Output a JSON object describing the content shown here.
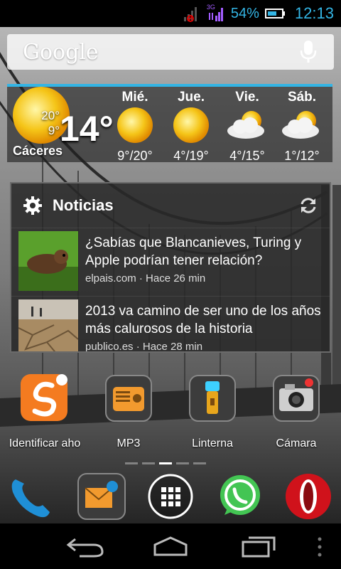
{
  "status_bar": {
    "network_type": "3G",
    "battery_percent": "54%",
    "time": "12:13"
  },
  "search": {
    "logo_text": "Google",
    "mic_icon": "microphone-icon"
  },
  "weather": {
    "high": "20°",
    "low": "9°",
    "current_temp": "14°",
    "city": "Cáceres",
    "forecast": [
      {
        "day": "Mié.",
        "range": "9°/20°",
        "icon": "sun-icon"
      },
      {
        "day": "Jue.",
        "range": "4°/19°",
        "icon": "sun-icon"
      },
      {
        "day": "Vie.",
        "range": "4°/15°",
        "icon": "partly-cloudy-icon"
      },
      {
        "day": "Sáb.",
        "range": "1°/12°",
        "icon": "partly-cloudy-icon"
      }
    ]
  },
  "news": {
    "title": "Noticias",
    "items": [
      {
        "headline": "¿Sabías que Blancanieves, Turing y Apple podrían tener relación?",
        "meta": "elpais.com · Hace 26 min"
      },
      {
        "headline": "2013 va camino de ser uno de los años más calurosos de la historia",
        "meta": "publico.es · Hace 28 min"
      }
    ]
  },
  "apps": [
    {
      "label": "Identificar aho",
      "icon": "soundhound-icon"
    },
    {
      "label": "MP3",
      "icon": "radio-icon"
    },
    {
      "label": "Linterna",
      "icon": "flashlight-icon"
    },
    {
      "label": "Cámara",
      "icon": "camera-icon"
    }
  ],
  "dock": [
    {
      "icon": "phone-icon"
    },
    {
      "icon": "email-icon"
    },
    {
      "icon": "app-drawer-icon"
    },
    {
      "icon": "whatsapp-icon"
    },
    {
      "icon": "opera-icon"
    }
  ],
  "colors": {
    "accent": "#33b5e5",
    "signal_purple": "#a35dff"
  }
}
